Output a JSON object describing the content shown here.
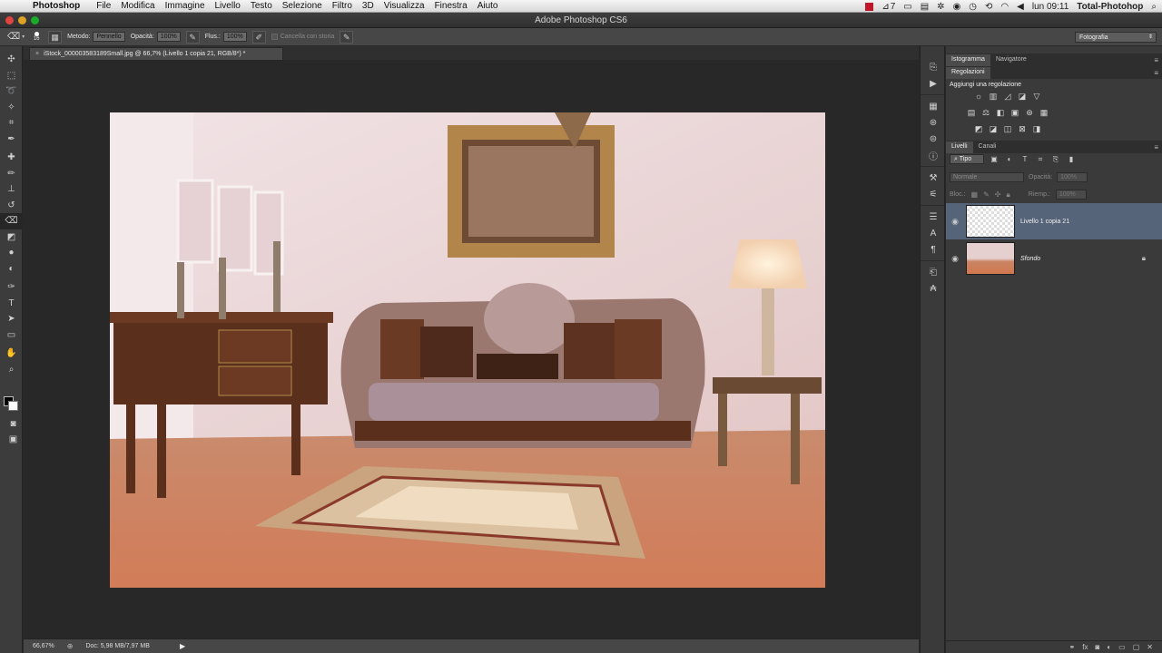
{
  "menubar": {
    "app_name": "Photoshop",
    "menus": [
      "File",
      "Modifica",
      "Immagine",
      "Livello",
      "Testo",
      "Selezione",
      "Filtro",
      "3D",
      "Visualizza",
      "Finestra",
      "Aiuto"
    ],
    "status_number": "7",
    "clock": "lun 09:11",
    "user": "Total-Photohop"
  },
  "window": {
    "title": "Adobe Photoshop CS6"
  },
  "options": {
    "brush_size": "16",
    "mode_label": "Metodo:",
    "mode_value": "Pennello",
    "opacity_label": "Opacità:",
    "opacity_value": "100%",
    "flow_label": "Flus.:",
    "flow_value": "100%",
    "history_label": "Cancella con storia",
    "workspace": "Fotografia"
  },
  "document": {
    "tab_title": "iStock_000003583189Small.jpg @ 66,7% (Livello 1 copia 21, RGB/8*) *",
    "zoom": "66,67%",
    "doc_info": "Doc: 5,98 MB/7,97 MB"
  },
  "panels": {
    "top_tabs": [
      "Istogramma",
      "Navigatore"
    ],
    "adjustments_tab": "Regolazioni",
    "adjustments_header": "Aggiungi una regolazione",
    "layers_tabs": [
      "Livelli",
      "Canali"
    ],
    "filter_kind": "Tipo",
    "blend_mode": "Normale",
    "opacity_label": "Opacità:",
    "opacity_value": "100%",
    "lock_label": "Bloc.:",
    "fill_label": "Riemp.:",
    "fill_value": "100%",
    "layers": [
      {
        "name": "Livello 1 copia 21",
        "selected": true
      },
      {
        "name": "Sfondo",
        "selected": false,
        "locked": true
      }
    ]
  },
  "colors": {
    "panel": "#3a3a3a",
    "canvas_bg": "#282828",
    "layer_selected": "#56647a"
  }
}
